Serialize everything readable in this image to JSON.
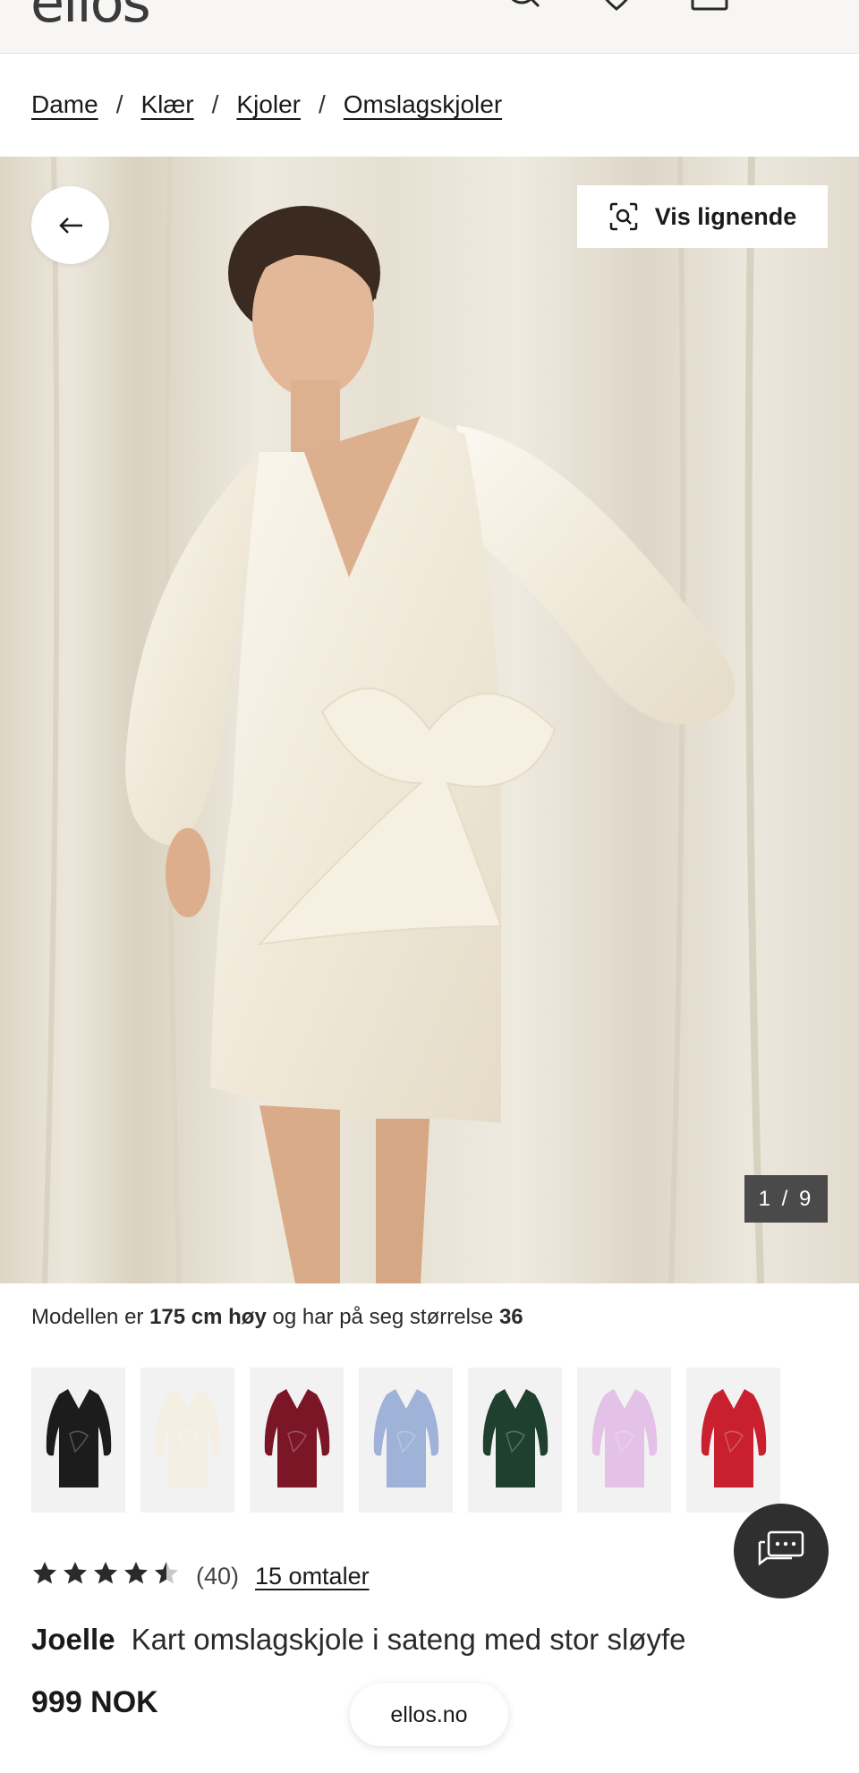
{
  "header": {
    "logo": "ellos",
    "icons": [
      "search-icon",
      "heart-icon",
      "bag-icon",
      "menu-icon"
    ]
  },
  "breadcrumb": [
    "Dame",
    "Klær",
    "Kjoler",
    "Omslagskjoler"
  ],
  "gallery": {
    "back_icon": "arrow-left-icon",
    "vis_lignende_label": "Vis lignende",
    "vis_lignende_icon": "visual-search-icon",
    "counter": "1 / 9"
  },
  "model_info": {
    "prefix": "Modellen er ",
    "height": "175 cm høy",
    "middle": " og har på seg størrelse ",
    "size": "36"
  },
  "color_variants": [
    {
      "name": "black",
      "color": "#1c1c1c"
    },
    {
      "name": "cream",
      "color": "#f4efe2"
    },
    {
      "name": "burgundy",
      "color": "#7a1626"
    },
    {
      "name": "light-blue",
      "color": "#9fb3d8"
    },
    {
      "name": "dark-green",
      "color": "#1f3f2f"
    },
    {
      "name": "lilac",
      "color": "#e4c1e6"
    },
    {
      "name": "red",
      "color": "#c8202e"
    }
  ],
  "rating": {
    "value": 4.5,
    "max": 5,
    "count_label": "(40)",
    "reviews_label": "15 omtaler"
  },
  "product": {
    "brand": "Joelle",
    "name": "Kart omslagskjole i sateng med stor sløyfe",
    "price": "999 NOK"
  },
  "chat_icon": "chat-icon",
  "domain_pill": "ellos.no"
}
